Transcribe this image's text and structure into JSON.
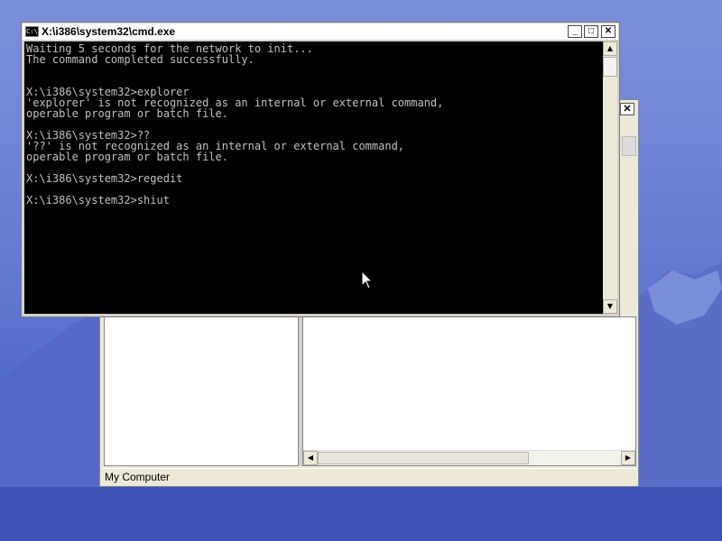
{
  "cmd_window": {
    "title": "X:\\i386\\system32\\cmd.exe",
    "icon_label": "C:\\",
    "minimize_glyph": "_",
    "maximize_glyph": "□",
    "close_glyph": "✕",
    "console_lines": [
      "Waiting 5 seconds for the network to init...",
      "The command completed successfully.",
      "",
      "",
      "X:\\i386\\system32>explorer",
      "'explorer' is not recognized as an internal or external command,",
      "operable program or batch file.",
      "",
      "X:\\i386\\system32>??",
      "'??' is not recognized as an internal or external command,",
      "operable program or batch file.",
      "",
      "X:\\i386\\system32>regedit",
      "",
      "X:\\i386\\system32>shiut"
    ],
    "scroll_up_glyph": "▲",
    "scroll_down_glyph": "▼"
  },
  "regedit_window": {
    "close_glyph": "✕",
    "status_text": "My Computer",
    "scroll_left_glyph": "◀",
    "scroll_right_glyph": "▶"
  },
  "colors": {
    "console_bg": "#000000",
    "console_fg": "#c0c0c0",
    "desktop_sky": "#6f84d6"
  }
}
